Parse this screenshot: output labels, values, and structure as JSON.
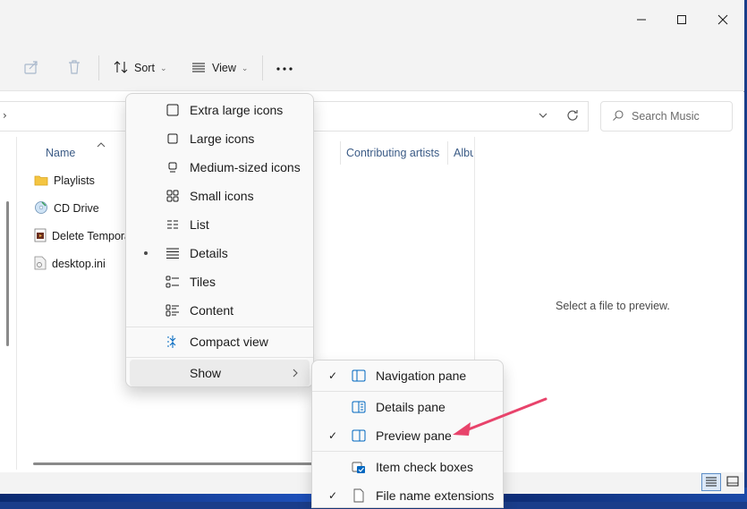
{
  "window": {
    "controls": {
      "minimize": "minimize-icon",
      "maximize": "maximize-icon",
      "close": "close-icon"
    }
  },
  "toolbar": {
    "sort_label": "Sort",
    "view_label": "View",
    "more_icon": "more-icon"
  },
  "search": {
    "placeholder": "Search Music"
  },
  "columns": [
    "Name",
    "Contributing artists",
    "Albu"
  ],
  "files": [
    {
      "name": "Playlists",
      "icon": "folder-icon"
    },
    {
      "name": "CD Drive",
      "icon": "cd-drive-icon"
    },
    {
      "name": "Delete Tempora",
      "icon": "media-file-icon"
    },
    {
      "name": "desktop.ini",
      "icon": "settings-file-icon"
    }
  ],
  "preview": {
    "text": "Select a file to preview."
  },
  "view_menu": {
    "items": [
      {
        "label": "Extra large icons",
        "icon": "extra-large-icons-icon"
      },
      {
        "label": "Large icons",
        "icon": "large-icons-icon"
      },
      {
        "label": "Medium-sized icons",
        "icon": "medium-icons-icon"
      },
      {
        "label": "Small icons",
        "icon": "small-icons-icon"
      },
      {
        "label": "List",
        "icon": "list-icon"
      },
      {
        "label": "Details",
        "icon": "details-icon",
        "selected": true
      },
      {
        "label": "Tiles",
        "icon": "tiles-icon"
      },
      {
        "label": "Content",
        "icon": "content-icon"
      },
      {
        "label": "Compact view",
        "icon": "compact-view-icon"
      },
      {
        "label": "Show",
        "icon": "",
        "submenu": true
      }
    ]
  },
  "show_menu": {
    "items": [
      {
        "label": "Navigation pane",
        "checked": true,
        "icon": "navigation-pane-icon"
      },
      {
        "label": "Details pane",
        "checked": false,
        "icon": "details-pane-icon"
      },
      {
        "label": "Preview pane",
        "checked": true,
        "icon": "preview-pane-icon"
      },
      {
        "label": "Item check boxes",
        "checked": false,
        "icon": "item-check-boxes-icon"
      },
      {
        "label": "File name extensions",
        "checked": true,
        "icon": "file-extensions-icon"
      }
    ]
  },
  "colors": {
    "accent": "#0067c0",
    "arrow": "#e8436b",
    "menu_bg": "#f9f9f9"
  }
}
